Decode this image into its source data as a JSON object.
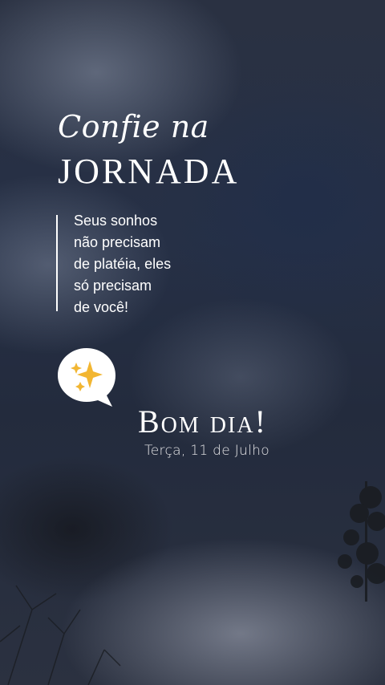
{
  "story": {
    "title_script": "Confie na",
    "title_main": "JORNADA",
    "quote_lines": [
      "Seus sonhos",
      "não precisam",
      "de platéia, eles",
      "só precisam",
      "de você!"
    ],
    "greeting": "Bom dia!",
    "date": "Terça, 11 de Julho"
  },
  "icons": {
    "bubble": "speech-bubble-icon",
    "sparkles": "sparkles-icon"
  },
  "colors": {
    "text": "#ffffff",
    "sparkle": "#f2b632",
    "bubble": "#ffffff"
  }
}
